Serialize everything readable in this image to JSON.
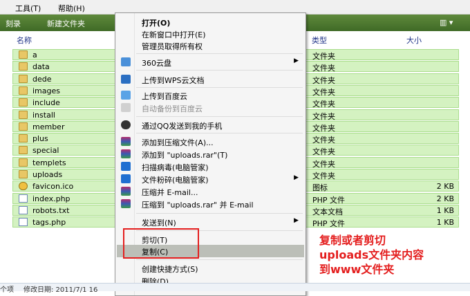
{
  "menubar": {
    "items": [
      "工具(T)",
      "帮助(H)"
    ]
  },
  "toolbar": {
    "burn": "刻录",
    "new_folder": "新建文件夹"
  },
  "columns": {
    "name": "名称",
    "type": "类型",
    "size": "大小"
  },
  "files": [
    {
      "name": "a",
      "type": "文件夹",
      "size": "",
      "kind": "folder"
    },
    {
      "name": "data",
      "type": "文件夹",
      "size": "",
      "kind": "folder"
    },
    {
      "name": "dede",
      "type": "文件夹",
      "size": "",
      "kind": "folder"
    },
    {
      "name": "images",
      "type": "文件夹",
      "size": "",
      "kind": "folder"
    },
    {
      "name": "include",
      "type": "文件夹",
      "size": "",
      "kind": "folder"
    },
    {
      "name": "install",
      "type": "文件夹",
      "size": "",
      "kind": "folder"
    },
    {
      "name": "member",
      "type": "文件夹",
      "size": "",
      "kind": "folder"
    },
    {
      "name": "plus",
      "type": "文件夹",
      "size": "",
      "kind": "folder"
    },
    {
      "name": "special",
      "type": "文件夹",
      "size": "",
      "kind": "folder"
    },
    {
      "name": "templets",
      "type": "文件夹",
      "size": "",
      "kind": "folder"
    },
    {
      "name": "uploads",
      "type": "文件夹",
      "size": "",
      "kind": "folder"
    },
    {
      "name": "favicon.ico",
      "type": "图标",
      "size": "2 KB",
      "kind": "icon"
    },
    {
      "name": "index.php",
      "type": "PHP 文件",
      "size": "2 KB",
      "kind": "file"
    },
    {
      "name": "robots.txt",
      "type": "文本文档",
      "size": "1 KB",
      "kind": "file"
    },
    {
      "name": "tags.php",
      "type": "PHP 文件",
      "size": "1 KB",
      "kind": "file"
    }
  ],
  "context_menu": {
    "open": "打开(O)",
    "open_new_window": "在新窗口中打开(E)",
    "take_ownership": "管理员取得所有权",
    "cloud360": "360云盘",
    "upload_wps": "上传到WPS云文档",
    "upload_baidu": "上传到百度云",
    "auto_backup_baidu": "自动备份到百度云",
    "send_qq_phone": "通过QQ发送到我的手机",
    "add_archive": "添加到压缩文件(A)...",
    "add_uploads_rar": "添加到 \"uploads.rar\"(T)",
    "scan_virus": "扫描病毒(电脑管家)",
    "shred": "文件粉碎(电脑管家)",
    "compress_email": "压缩并 E-mail...",
    "compress_rar_email": "压缩到 \"uploads.rar\" 并 E-mail",
    "send_to": "发送到(N)",
    "cut": "剪切(T)",
    "copy": "复制(C)",
    "create_shortcut": "创建快捷方式(S)",
    "delete": "删除(D)"
  },
  "annotation": {
    "line1": "复制或者剪切",
    "line2": "uploads文件夹内容",
    "line3": "到www文件夹"
  },
  "status": {
    "items": "个项",
    "modified": "修改日期: 2011/7/1 16"
  },
  "colors": {
    "selection": "#d4f2c1",
    "accent_red": "#e41e1e",
    "toolbar": "#4f7a31"
  }
}
